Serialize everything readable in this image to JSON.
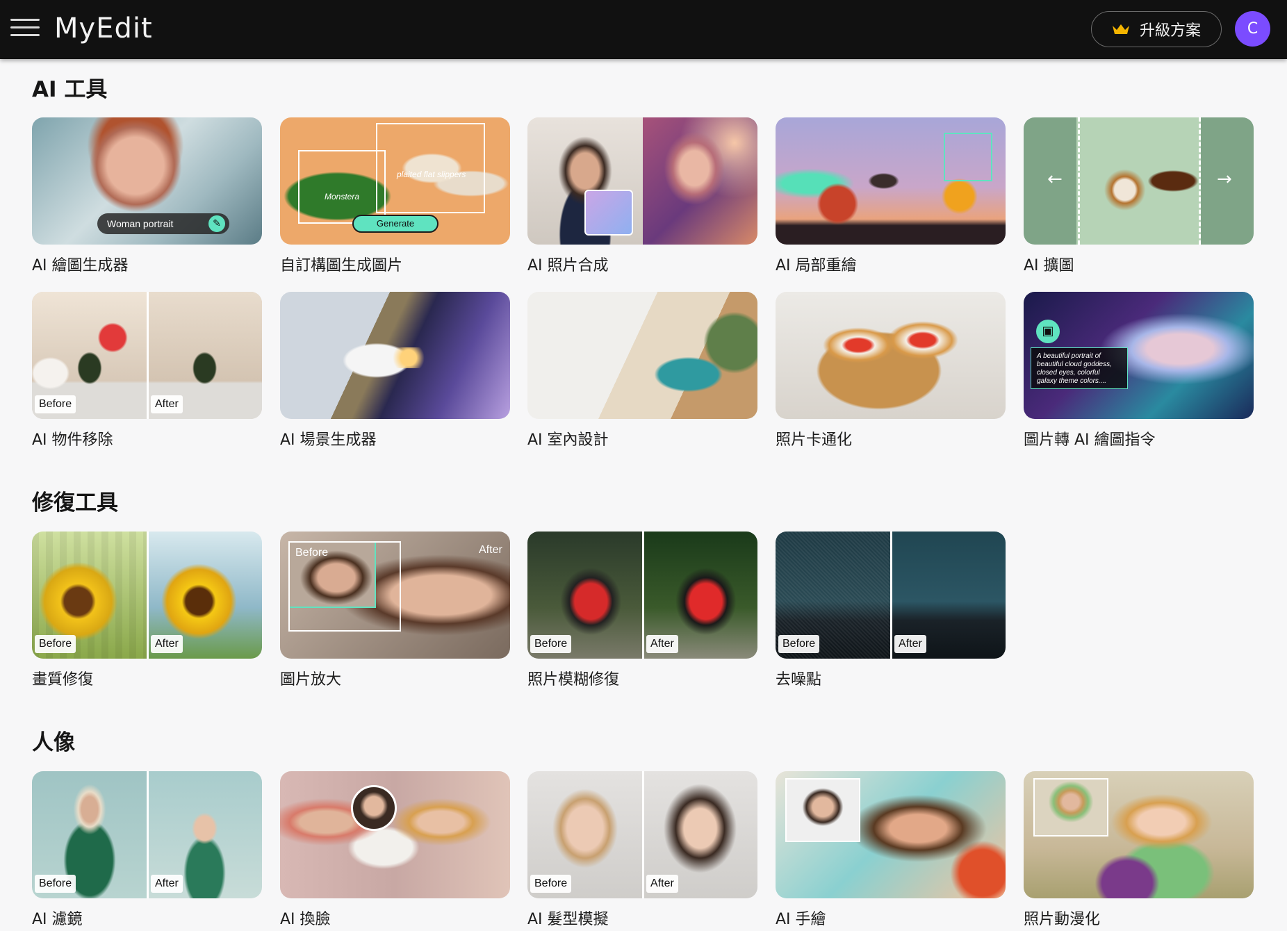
{
  "header": {
    "logo": "MyEdit",
    "upgrade_label": "升級方案",
    "avatar_letter": "C"
  },
  "sections": {
    "ai_tools": {
      "title": "AI 工具",
      "cards": [
        {
          "label": "AI 繪圖生成器",
          "prompt_chip": "Woman portrait"
        },
        {
          "label": "自訂構圖生成圖片",
          "tag_1": "Monstera",
          "tag_2": "plaited flat slippers",
          "button": "Generate"
        },
        {
          "label": "AI 照片合成"
        },
        {
          "label": "AI 局部重繪"
        },
        {
          "label": "AI 擴圖"
        },
        {
          "label": "AI 物件移除",
          "before": "Before",
          "after": "After"
        },
        {
          "label": "AI 場景生成器"
        },
        {
          "label": "AI 室內設計"
        },
        {
          "label": "照片卡通化"
        },
        {
          "label": "圖片轉 AI 繪圖指令",
          "prompt_text": "A beautiful portrait of beautiful cloud goddess, closed eyes, colorful galaxy theme colors...."
        }
      ]
    },
    "repair_tools": {
      "title": "修復工具",
      "cards": [
        {
          "label": "畫質修復",
          "before": "Before",
          "after": "After"
        },
        {
          "label": "圖片放大",
          "before": "Before",
          "after": "After"
        },
        {
          "label": "照片模糊修復",
          "before": "Before",
          "after": "After"
        },
        {
          "label": "去噪點",
          "before": "Before",
          "after": "After"
        }
      ]
    },
    "portrait": {
      "title": "人像",
      "cards": [
        {
          "label": "AI 濾鏡",
          "before": "Before",
          "after": "After"
        },
        {
          "label": "AI 換臉"
        },
        {
          "label": "AI 髮型模擬",
          "before": "Before",
          "after": "After"
        },
        {
          "label": "AI 手繪"
        },
        {
          "label": "照片動漫化"
        }
      ]
    }
  }
}
